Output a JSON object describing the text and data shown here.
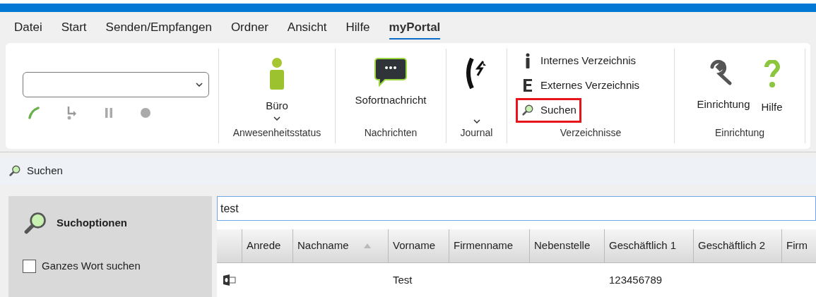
{
  "menu": [
    {
      "label": "Datei",
      "selected": false
    },
    {
      "label": "Start",
      "selected": false
    },
    {
      "label": "Senden/Empfangen",
      "selected": false
    },
    {
      "label": "Ordner",
      "selected": false
    },
    {
      "label": "Ansicht",
      "selected": false
    },
    {
      "label": "Hilfe",
      "selected": false
    },
    {
      "label": "myPortal",
      "selected": true
    }
  ],
  "ribbon": {
    "groups": [
      {
        "kind": "phone"
      },
      {
        "kind": "presence",
        "caption": "Anwesenheitsstatus",
        "label": "Büro"
      },
      {
        "kind": "message",
        "caption": "Nachrichten",
        "label": "Sofortnachricht"
      },
      {
        "kind": "journal",
        "caption": "Journal"
      },
      {
        "kind": "directories",
        "caption": "Verzeichnisse",
        "items": [
          {
            "label": "Internes Verzeichnis",
            "highlighted": false
          },
          {
            "label": "Externes Verzeichnis",
            "highlighted": false
          },
          {
            "label": "Suchen",
            "highlighted": true
          }
        ]
      },
      {
        "kind": "setup",
        "caption": "Einrichtung",
        "buttons": [
          {
            "label": "Einrichtung"
          },
          {
            "label": "Hilfe"
          }
        ]
      }
    ]
  },
  "pane_title": "Suchen",
  "options": {
    "title": "Suchoptionen",
    "checkbox": {
      "label": "Ganzes Wort suchen",
      "checked": false
    }
  },
  "search": {
    "value": "test"
  },
  "table": {
    "columns": [
      {
        "label": "Anrede",
        "sorted": false
      },
      {
        "label": "Nachname",
        "sorted": true
      },
      {
        "label": "Vorname",
        "sorted": false
      },
      {
        "label": "Firmenname",
        "sorted": false
      },
      {
        "label": "Nebenstelle",
        "sorted": false
      },
      {
        "label": "Geschäftlich 1",
        "sorted": false
      },
      {
        "label": "Geschäftlich 2",
        "sorted": false
      },
      {
        "label": "Firm",
        "sorted": false
      }
    ],
    "rows": [
      {
        "cells": [
          null,
          null,
          "Test",
          null,
          null,
          "123456789",
          null,
          null
        ]
      }
    ]
  }
}
